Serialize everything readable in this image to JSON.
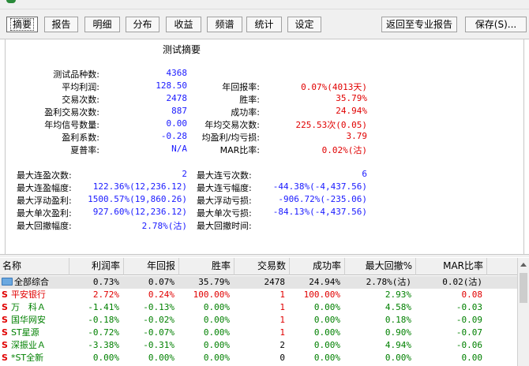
{
  "tabs": [
    {
      "label": "摘要"
    },
    {
      "label": "报告"
    },
    {
      "label": "明细"
    },
    {
      "label": "分布"
    },
    {
      "label": "收益"
    },
    {
      "label": "频谱"
    },
    {
      "label": "统计"
    },
    {
      "label": "设定"
    }
  ],
  "buttons": {
    "back": "返回至专业报告",
    "save": "保存(S)..."
  },
  "summary": {
    "title": "测试摘要",
    "block1": {
      "product_count": {
        "label": "测试品种数:",
        "value": "4368"
      },
      "avg_profit": {
        "label": "平均利润:",
        "value": "128.50"
      },
      "annual_return": {
        "label": "年回报率:",
        "value": "0.07%(4013天)"
      },
      "trades": {
        "label": "交易次数:",
        "value": "2478"
      },
      "win_rate": {
        "label": "胜率:",
        "value": "35.79%"
      },
      "win_trades": {
        "label": "盈利交易次数:",
        "value": "887"
      },
      "success_rate": {
        "label": "成功率:",
        "value": "24.94%"
      },
      "annual_signals": {
        "label": "年均信号数量:",
        "value": "0.00"
      },
      "annual_trades": {
        "label": "年均交易次数:",
        "value": "225.53次(0.05)"
      },
      "profit_factor": {
        "label": "盈利系数:",
        "value": "-0.28"
      },
      "avg_win_loss": {
        "label": "均盈利/均亏损:",
        "value": "3.79"
      },
      "sharpe": {
        "label": "夏普率:",
        "value": "N/A"
      },
      "mar": {
        "label": "MAR比率:",
        "value": "0.02%(沽)"
      }
    },
    "block2": {
      "max_consec_wins": {
        "label": "最大连盈次数:",
        "value": "2"
      },
      "max_consec_losses": {
        "label": "最大连亏次数:",
        "value": "6"
      },
      "max_consec_win_pct": {
        "label": "最大连盈幅度:",
        "value": "122.36%(12,236.12)"
      },
      "max_consec_loss_pct": {
        "label": "最大连亏幅度:",
        "value": "-44.38%(-4,437.56)"
      },
      "max_float_profit": {
        "label": "最大浮动盈利:",
        "value": "1500.57%(19,860.26)"
      },
      "max_float_loss": {
        "label": "最大浮动亏损:",
        "value": "-906.72%(-235.06)"
      },
      "max_single_profit": {
        "label": "最大单次盈利:",
        "value": "927.60%(12,236.12)"
      },
      "max_single_loss": {
        "label": "最大单次亏损:",
        "value": "-84.13%(-4,437.56)"
      },
      "max_drawdown": {
        "label": "最大回撤幅度:",
        "value": "2.78%(沽)"
      },
      "max_drawdown_time": {
        "label": "最大回撤时间:",
        "value": ""
      }
    }
  },
  "table": {
    "headers": [
      "名称",
      "利润率",
      "年回报",
      "胜率",
      "交易数",
      "成功率",
      "最大回撤%",
      "MAR比率"
    ],
    "rows": [
      {
        "name": "全部综合",
        "type": "folder",
        "v": [
          "0.73%",
          "0.07%",
          "35.79%",
          "2478",
          "24.94%",
          "2.78%(沽)",
          "0.02(沽)"
        ]
      },
      {
        "name": "平安银行",
        "type": "stock",
        "v": [
          "2.72%",
          "0.24%",
          "100.00%",
          "1",
          "100.00%",
          "2.93%",
          "0.08"
        ]
      },
      {
        "name": "万　科Ａ",
        "type": "stock",
        "v": [
          "-1.41%",
          "-0.13%",
          "0.00%",
          "1",
          "0.00%",
          "4.58%",
          "-0.03"
        ]
      },
      {
        "name": "国华网安",
        "type": "stock",
        "v": [
          "-0.18%",
          "-0.02%",
          "0.00%",
          "1",
          "0.00%",
          "0.18%",
          "-0.09"
        ]
      },
      {
        "name": "ST星源",
        "type": "stock",
        "v": [
          "-0.72%",
          "-0.07%",
          "0.00%",
          "1",
          "0.00%",
          "0.90%",
          "-0.07"
        ]
      },
      {
        "name": "深振业Ａ",
        "type": "stock",
        "v": [
          "-3.38%",
          "-0.31%",
          "0.00%",
          "2",
          "0.00%",
          "4.94%",
          "-0.06"
        ]
      },
      {
        "name": "*ST全新",
        "type": "stock",
        "v": [
          "0.00%",
          "0.00%",
          "0.00%",
          "0",
          "0.00%",
          "0.00%",
          "0.00"
        ]
      }
    ]
  },
  "colors": {
    "positive": "#e00000",
    "negative": "#008000",
    "neutral": "#000000",
    "value": "#1a1aff"
  }
}
